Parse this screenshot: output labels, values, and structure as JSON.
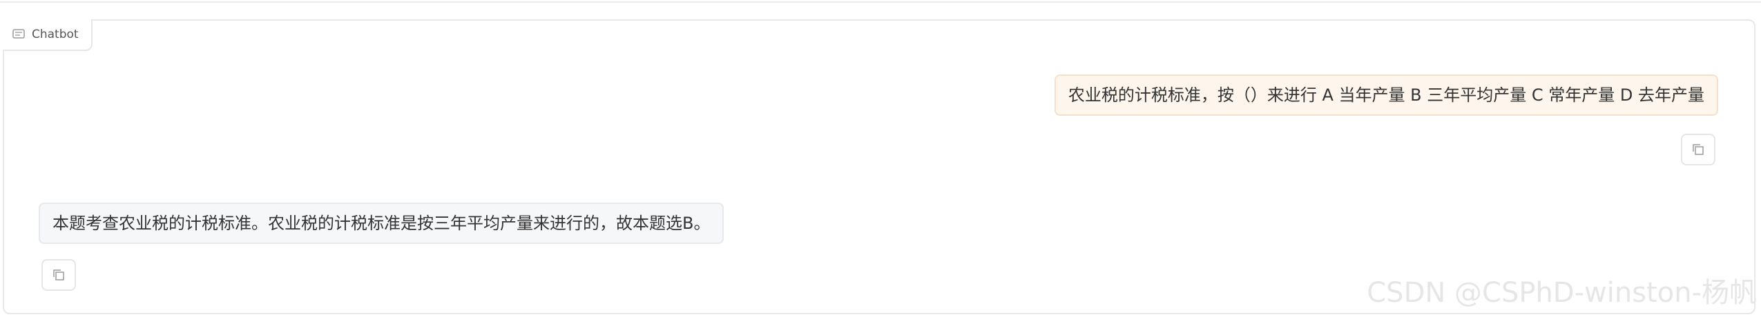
{
  "header": {
    "label": "Chatbot",
    "icon": "chat-icon"
  },
  "messages": [
    {
      "role": "user",
      "text": "农业税的计税标准，按（）来进行 A 当年产量 B 三年平均产量 C 常年产量 D 去年产量"
    },
    {
      "role": "bot",
      "text": "本题考查农业税的计税标准。农业税的计税标准是按三年平均产量来进行的，故本题选B。"
    }
  ],
  "watermark": "CSDN @CSPhD-winston-杨帆",
  "colors": {
    "user_bubble": "#fef6ec",
    "bot_bubble": "#f6f7f9",
    "border": "#e6e6e6"
  }
}
